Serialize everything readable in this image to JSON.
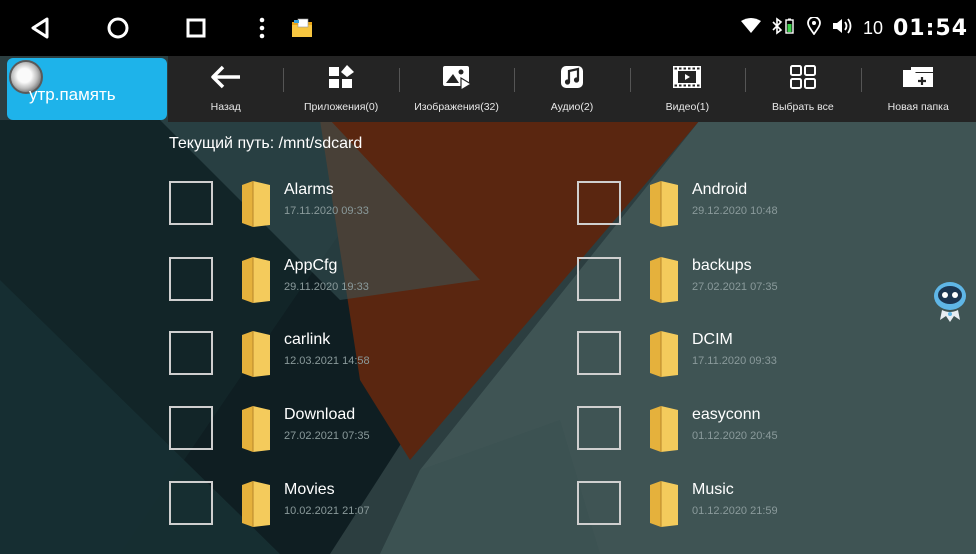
{
  "statusbar": {
    "vol_level": "10",
    "time": "01:54"
  },
  "storage": {
    "label": "утр.память"
  },
  "toolbar": [
    {
      "label": "Назад",
      "icon": "back-arrow-icon"
    },
    {
      "label": "Приложения(0)",
      "icon": "apps-icon"
    },
    {
      "label": "Изображения(32)",
      "icon": "images-icon"
    },
    {
      "label": "Аудио(2)",
      "icon": "music-note-icon"
    },
    {
      "label": "Видео(1)",
      "icon": "video-icon"
    },
    {
      "label": "Выбрать все",
      "icon": "select-all-icon"
    },
    {
      "label": "Новая папка",
      "icon": "new-folder-icon"
    }
  ],
  "path": "Текущий путь: /mnt/sdcard",
  "files": [
    {
      "name": "Alarms",
      "date": "17.11.2020 09:33"
    },
    {
      "name": "Android",
      "date": "29.12.2020 10:48"
    },
    {
      "name": "AppCfg",
      "date": "29.11.2020 19:33"
    },
    {
      "name": "backups",
      "date": "27.02.2021 07:35"
    },
    {
      "name": "carlink",
      "date": "12.03.2021 14:58"
    },
    {
      "name": "DCIM",
      "date": "17.11.2020 09:33"
    },
    {
      "name": "Download",
      "date": "27.02.2021 07:35"
    },
    {
      "name": "easyconn",
      "date": "01.12.2020 20:45"
    },
    {
      "name": "Movies",
      "date": "10.02.2021 21:07"
    },
    {
      "name": "Music",
      "date": "01.12.2020 21:59"
    }
  ],
  "colors": {
    "accent": "#1eb3ea",
    "toolbar_bg": "#242424",
    "folder": "#f2c94c",
    "brown_stripe": "#6b2a12"
  }
}
